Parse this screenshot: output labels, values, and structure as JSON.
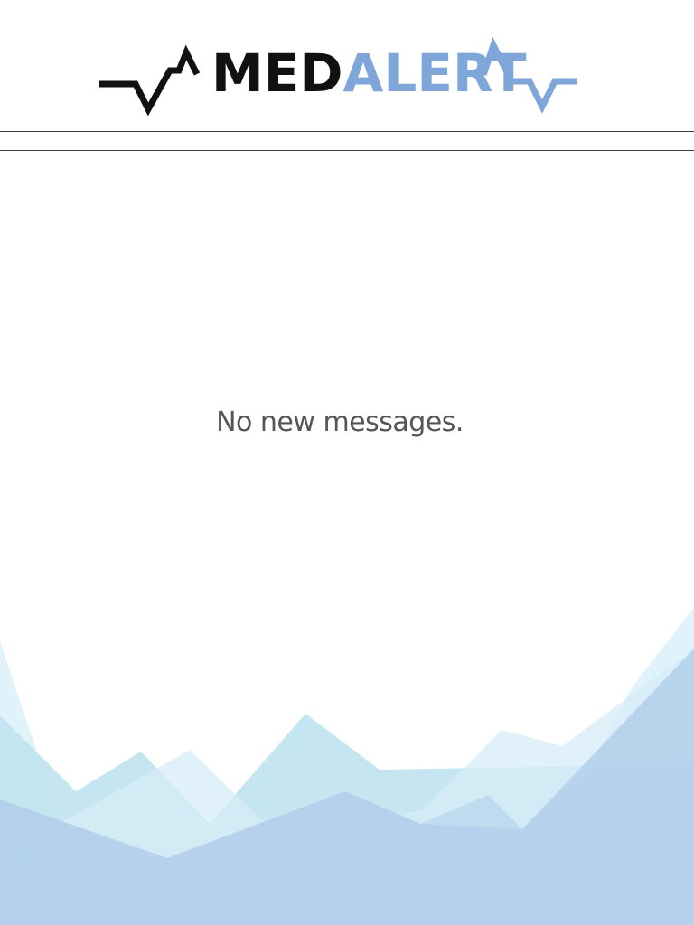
{
  "app": {
    "logo_part1": "MED",
    "logo_part2": "ALERT"
  },
  "main": {
    "empty_message": "No new messages."
  },
  "colors": {
    "brand_dark": "#111111",
    "brand_blue": "#7ea6d9",
    "rule": "#3a3a3a",
    "message_text": "#555555",
    "mountain_light": "#d4ecf7",
    "mountain_teal": "#b8e0ec",
    "mountain_blue": "#b4d0ec"
  }
}
